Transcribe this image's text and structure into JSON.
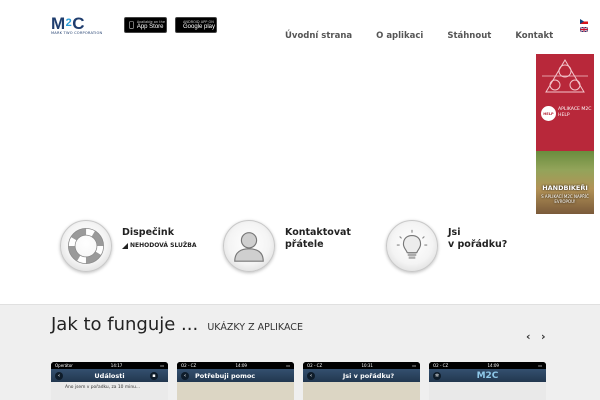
{
  "header": {
    "logo_text": "M2C",
    "logo_subtext": "MARK TWO CORPORATION",
    "app_store": {
      "small": "Available on the",
      "big": "App Store"
    },
    "google_play": {
      "small": "ANDROID APP ON",
      "big": "Google play"
    }
  },
  "nav": {
    "items": [
      {
        "label": "Úvodní strana"
      },
      {
        "label": "O aplikaci"
      },
      {
        "label": "Stáhnout"
      },
      {
        "label": "Kontakt"
      }
    ]
  },
  "languages": [
    "cz-flag-icon",
    "gb-flag-icon"
  ],
  "banner": {
    "help_badge": "HELP",
    "aplikace": "APLIKACE M2C HELP",
    "headline": "HANDBIKEŘI",
    "subline": "S APLIKACÍ M2C NAPŘÍČ EVROPOU!"
  },
  "features": [
    {
      "title_line1": "Dispečink",
      "title_line2": "",
      "subtitle": "NEHODOVÁ SLUŽBA",
      "icon": "lifebuoy-icon"
    },
    {
      "title_line1": "Kontaktovat",
      "title_line2": "přátele",
      "subtitle": "",
      "icon": "person-icon"
    },
    {
      "title_line1": "Jsi",
      "title_line2": "v pořádku?",
      "subtitle": "",
      "icon": "lightbulb-icon"
    }
  ],
  "how_it_works": {
    "title": "Jak to funguje ...",
    "subtitle": "UKÁZKY Z APLIKACE",
    "prev_label": "‹",
    "next_label": "›"
  },
  "phones": [
    {
      "status_left": "Operátor",
      "status_center": "14:17",
      "title": "Události",
      "body_text": "Ano jsem v pořadku, za 10 minu..."
    },
    {
      "status_left": "O2 - CZ",
      "status_center": "14:09",
      "title": "Potřebuji pomoc",
      "body_text": ""
    },
    {
      "status_left": "O2 - CZ",
      "status_center": "10:31",
      "title": "Jsi v pořádku?",
      "body_text": ""
    },
    {
      "status_left": "O2 - CZ",
      "status_center": "14:09",
      "title": "M2C",
      "body_text": ""
    }
  ],
  "colors": {
    "brand_blue": "#1f3d6e",
    "brand_light_blue": "#2b9bd6",
    "banner_red": "#b8283a",
    "section_bg": "#efefef"
  }
}
